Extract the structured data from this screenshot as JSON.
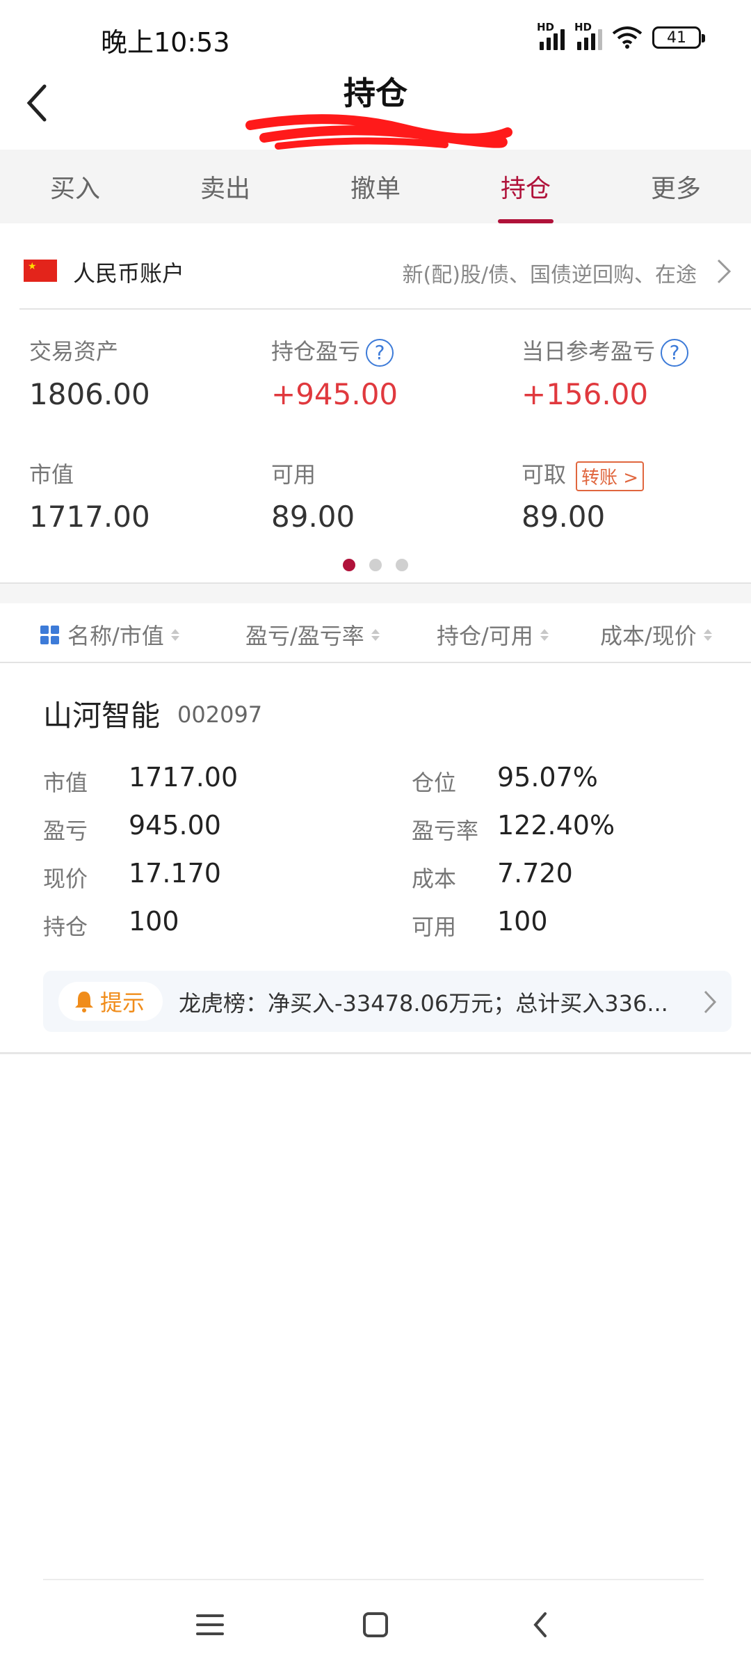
{
  "status_bar": {
    "time": "晚上10:53",
    "hd": "HD",
    "battery": "41"
  },
  "header": {
    "title": "持仓"
  },
  "tabs": [
    {
      "label": "买入"
    },
    {
      "label": "卖出"
    },
    {
      "label": "撤单"
    },
    {
      "label": "持仓",
      "active": true
    },
    {
      "label": "更多"
    }
  ],
  "account": {
    "label": "人民币账户",
    "description": "新(配)股/债、国债逆回购、在途"
  },
  "assets": {
    "trade_assets_label": "交易资产",
    "trade_assets_value": "1806.00",
    "position_pl_label": "持仓盈亏",
    "position_pl_value": "+945.00",
    "daily_pl_label": "当日参考盈亏",
    "daily_pl_value": "+156.00",
    "market_value_label": "市值",
    "market_value_value": "1717.00",
    "available_label": "可用",
    "available_value": "89.00",
    "withdrawable_label": "可取",
    "withdrawable_value": "89.00",
    "transfer_label": "转账 >",
    "question_mark": "?"
  },
  "page_indicator": {
    "count": 3,
    "active": 0
  },
  "columns": [
    "名称/市值",
    "盈亏/盈亏率",
    "持仓/可用",
    "成本/现价"
  ],
  "holding": {
    "name": "山河智能",
    "code": "002097",
    "fields": {
      "market_value_label": "市值",
      "market_value": "1717.00",
      "position_ratio_label": "仓位",
      "position_ratio": "95.07%",
      "pl_label": "盈亏",
      "pl": "945.00",
      "pl_rate_label": "盈亏率",
      "pl_rate": "122.40%",
      "price_label": "现价",
      "price": "17.170",
      "cost_label": "成本",
      "cost": "7.720",
      "quantity_label": "持仓",
      "quantity": "100",
      "available_label": "可用",
      "available": "100"
    },
    "tip": {
      "badge": "提示",
      "text": "龙虎榜：净买入-33478.06万元；总计买入336..."
    }
  },
  "colors": {
    "accent": "#b0123a",
    "gain": "#e0393e",
    "link": "#3d7bd8",
    "tip_orange": "#f08c1a"
  }
}
